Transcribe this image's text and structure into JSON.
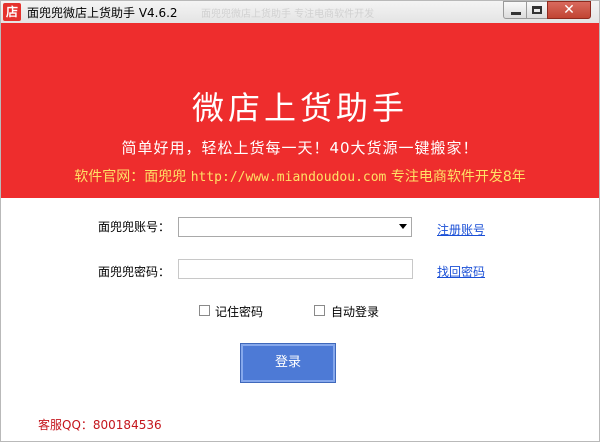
{
  "window": {
    "title": "面兜兜微店上货助手 V4.6.2",
    "app_icon_char": "店",
    "title_marquee": "面兜兜微店上货助手 专注电商软件开发"
  },
  "banner": {
    "title": "微店上货助手",
    "slogan": "简单好用，轻松上货每一天！40大货源一键搬家！",
    "site_prefix": "软件官网：面兜兜 ",
    "site_url": "http://www.miandoudou.com",
    "site_suffix": " 专注电商软件开发8年"
  },
  "form": {
    "account_label": "面兜兜账号：",
    "account_value": "",
    "password_label": "面兜兜密码：",
    "password_value": "",
    "register_link": "注册账号",
    "recover_link": "找回密码",
    "remember_label": "记住密码",
    "remember_checked": false,
    "auto_login_label": "自动登录",
    "auto_login_checked": false,
    "login_button": "登录"
  },
  "footer": {
    "support": "客服QQ：800184536"
  },
  "colors": {
    "banner": "#ee2d2d",
    "site_text": "#ffe066",
    "link": "#1a4fd6",
    "button": "#4d7ad6",
    "footer_text": "#c4151c"
  },
  "icons": [
    "app-store-icon",
    "minimize-icon",
    "maximize-icon",
    "close-icon",
    "dropdown-arrow-icon"
  ]
}
